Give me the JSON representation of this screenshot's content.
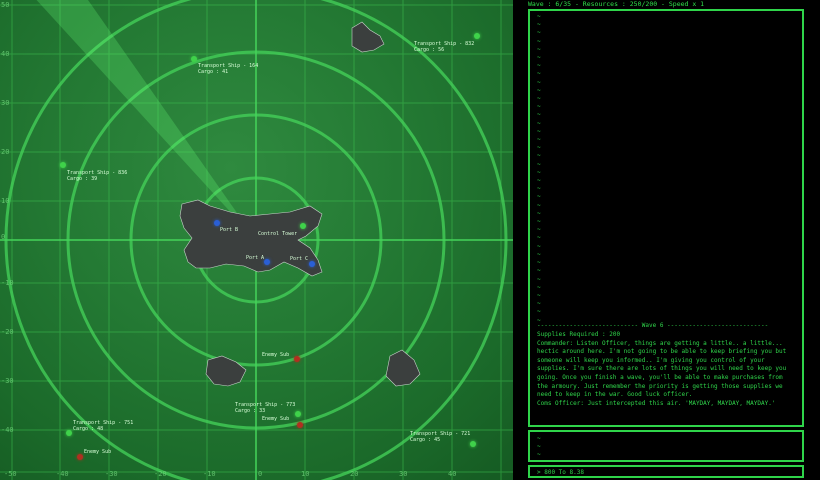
{
  "status": {
    "text": "Wave : 6/35 - Resources : 250/200 - Speed x 1"
  },
  "radar": {
    "contacts": [
      {
        "id": "ts-832",
        "label": "Transport Ship - 832\nCargo : 56",
        "color": "#3fd24a"
      },
      {
        "id": "ts-164",
        "label": "Transport Ship - 164\nCargo : 41",
        "color": "#3fd24a"
      },
      {
        "id": "ts-836",
        "label": "Transport Ship - 836\nCargo : 39",
        "color": "#3fd24a"
      },
      {
        "id": "control-tower",
        "label": "Control Tower",
        "color": "#3fd24a"
      },
      {
        "id": "port-b",
        "label": "Port B",
        "color": "#2a5fd6"
      },
      {
        "id": "port-a",
        "label": "Port A",
        "color": "#2a5fd6"
      },
      {
        "id": "port-c",
        "label": "Port C",
        "color": "#2a5fd6"
      },
      {
        "id": "enemy-sub-1",
        "label": "Enemy Sub",
        "color": "#b03020"
      },
      {
        "id": "ts-773",
        "label": "Transport Ship - 773\nCargo : 33",
        "color": "#3fd24a"
      },
      {
        "id": "enemy-sub-2",
        "label": "Enemy Sub",
        "color": "#b03020"
      },
      {
        "id": "ts-751",
        "label": "Transport Ship - 751\nCargo : 48",
        "color": "#3fd24a"
      },
      {
        "id": "enemy-sub-3",
        "label": "Enemy Sub",
        "color": "#b03020"
      },
      {
        "id": "ts-721",
        "label": "Transport Ship - 721\nCargo : 45",
        "color": "#3fd24a"
      }
    ],
    "y_ticks": [
      "50",
      "40",
      "30",
      "20",
      "10",
      "0",
      "-10",
      "-20",
      "-30",
      "-40"
    ],
    "x_ticks": [
      "-50",
      "-40",
      "-30",
      "-20",
      "-10",
      "0",
      "10",
      "20",
      "30",
      "40"
    ]
  },
  "console": {
    "wave_divider": "---------------------------- Wave 6 ----------------------------",
    "briefing": "Supplies Required : 200\nCommander: Listen Officer, things are getting a little.. a little... hectic around here. I'm not going to be able to keep briefing you but someone will keep you informed.. I'm giving you control of your supplies. I'm sure there are lots of things you will need to keep you going. Once you finish a wave, you'll be able to make purchases from the armoury. Just remember the priority is getting those supplies we need to keep in the war. Good luck officer.\nComs Officer: Just intercepted this air. 'MAYDAY, MAYDAY, MAYDAY.'",
    "input_text": "> 800 To 8.38"
  }
}
